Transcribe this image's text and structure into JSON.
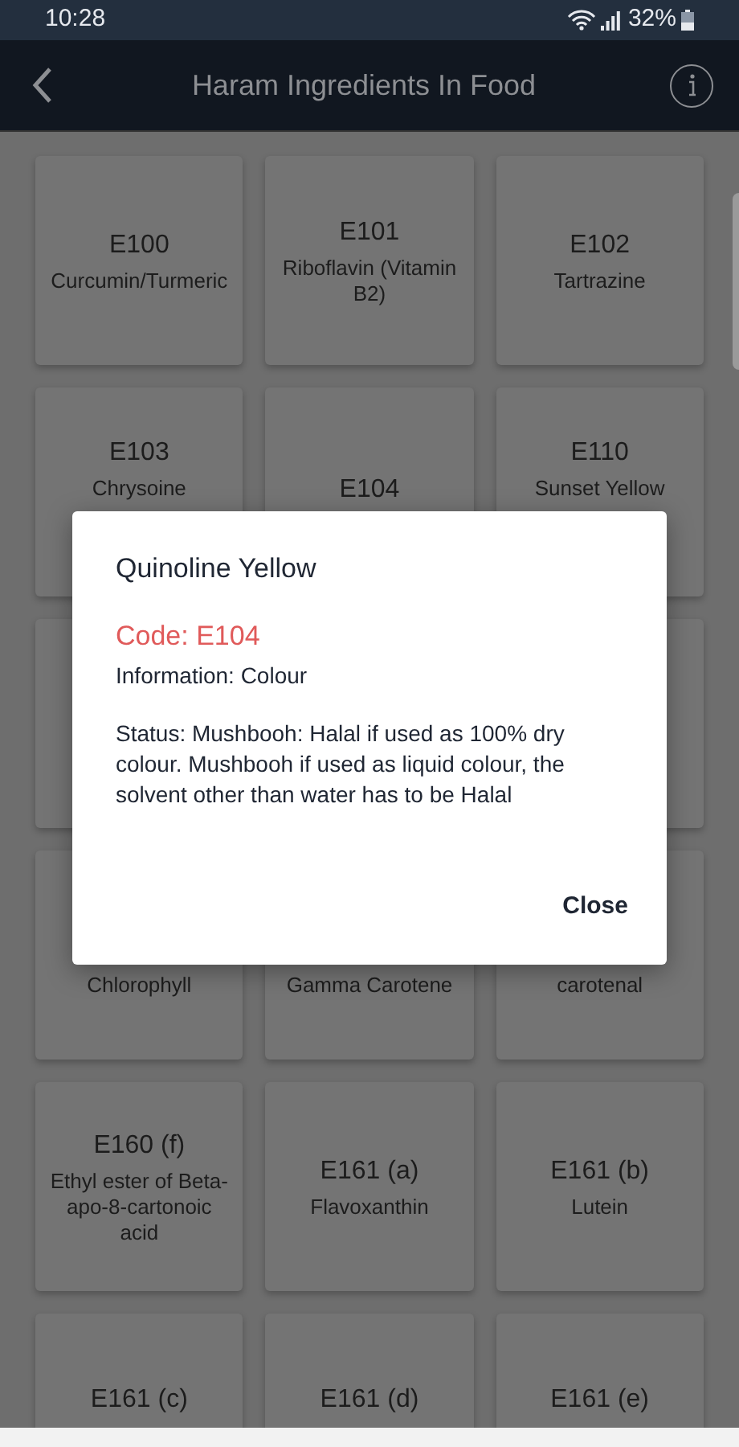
{
  "status_bar": {
    "time": "10:28",
    "battery": "32%"
  },
  "header": {
    "title": "Haram Ingredients In Food"
  },
  "cards": [
    {
      "kind": "item",
      "code": "E100",
      "lines": [
        "Curcumin/Turmeric"
      ]
    },
    {
      "kind": "item",
      "code": "E101",
      "lines": [
        "Riboflavin (Vitamin",
        "B2)"
      ]
    },
    {
      "kind": "item",
      "code": "E102",
      "lines": [
        "Tartrazine"
      ]
    },
    {
      "kind": "partial",
      "code": "E103",
      "lines": [
        "Chrysoine"
      ]
    },
    {
      "kind": "item",
      "code": "E104"
    },
    {
      "kind": "partial",
      "code": "E110",
      "lines": [
        "Sunset Yellow"
      ]
    },
    {
      "kind": "covered"
    },
    {
      "kind": "gap"
    },
    {
      "kind": "covered"
    },
    {
      "kind": "item",
      "lines": [
        "Chlorophyll"
      ]
    },
    {
      "kind": "item",
      "lines": [
        "Gamma Carotene"
      ]
    },
    {
      "kind": "item",
      "lines": [
        "carotenal"
      ]
    },
    {
      "kind": "item",
      "code": "E160 (f)",
      "lines": [
        "Ethyl ester of Beta-",
        "apo-8-cartonoic",
        "acid"
      ]
    },
    {
      "kind": "item",
      "code": "E161 (a)",
      "lines": [
        "Flavoxanthin"
      ]
    },
    {
      "kind": "item",
      "code": "E161 (b)",
      "lines": [
        "Lutein"
      ]
    },
    {
      "kind": "bottom",
      "code": "E161 (c)"
    },
    {
      "kind": "bottom",
      "code": "E161 (d)"
    },
    {
      "kind": "bottom",
      "code": "E161 (e)"
    }
  ],
  "dialog": {
    "title": "Quinoline Yellow",
    "code": "Code: E104",
    "information": "Information: Colour",
    "status": "Status: Mushbooh: Halal if used as 100% dry colour. Mushbooh if used as liquid colour, the solvent other than water has to be Halal",
    "close": "Close"
  }
}
